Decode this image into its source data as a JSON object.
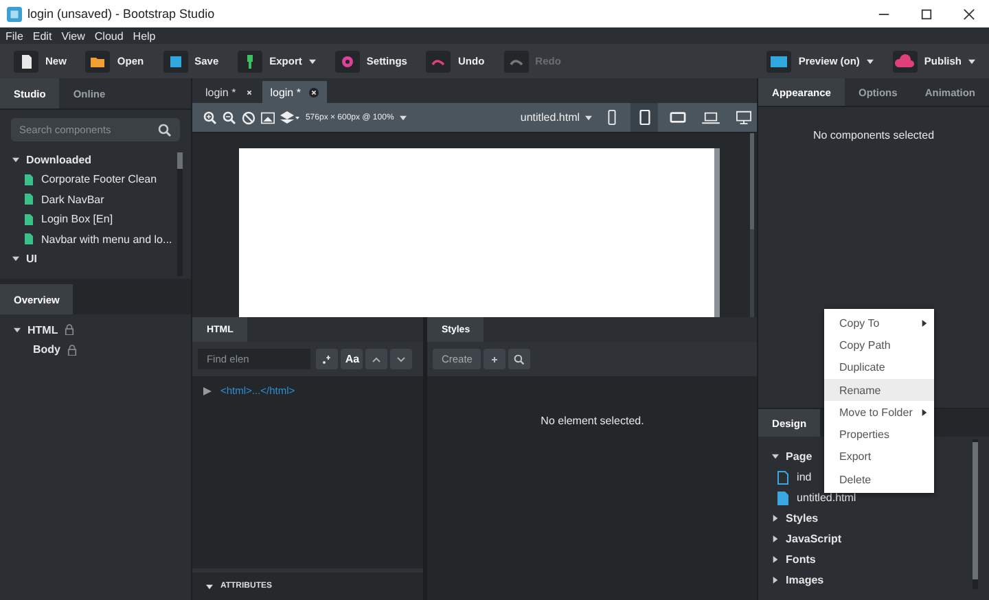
{
  "window": {
    "title": "login (unsaved) - Bootstrap Studio"
  },
  "menu": [
    "File",
    "Edit",
    "View",
    "Cloud",
    "Help"
  ],
  "toolbar": [
    {
      "kind": "new",
      "label": "New",
      "dropdown": false,
      "disabled": false
    },
    {
      "kind": "open",
      "label": "Open",
      "dropdown": false,
      "disabled": false
    },
    {
      "kind": "save",
      "label": "Save",
      "dropdown": false,
      "disabled": false
    },
    {
      "kind": "export",
      "label": "Export",
      "dropdown": true,
      "disabled": false
    },
    {
      "kind": "settings",
      "label": "Settings",
      "dropdown": false,
      "disabled": false
    },
    {
      "kind": "undo",
      "label": "Undo",
      "dropdown": false,
      "disabled": false
    },
    {
      "kind": "redo",
      "label": "Redo",
      "dropdown": false,
      "disabled": true
    }
  ],
  "toolbar_right": [
    {
      "kind": "preview",
      "label": "Preview (on)",
      "dropdown": true
    },
    {
      "kind": "publish",
      "label": "Publish",
      "dropdown": true
    }
  ],
  "left_tabs": [
    {
      "label": "Studio",
      "selected": true
    },
    {
      "label": "Online",
      "selected": false
    }
  ],
  "component_search": {
    "placeholder": "Search components"
  },
  "components": [
    {
      "label": "Downloaded",
      "expanded": true,
      "children": [
        {
          "label": "Corporate Footer Clean"
        },
        {
          "label": "Dark NavBar"
        },
        {
          "label": "Login Box [En]"
        },
        {
          "label": "Navbar with menu and lo..."
        }
      ]
    },
    {
      "label": "UI",
      "expanded": true
    }
  ],
  "overview": {
    "tab": "Overview",
    "tree": [
      {
        "label": "HTML",
        "expanded": true,
        "locked": true,
        "children": [
          {
            "label": "Body",
            "locked": true
          }
        ]
      }
    ]
  },
  "doc_tabs": [
    {
      "label": "login *",
      "selected": false
    },
    {
      "label": "login *",
      "selected": true
    }
  ],
  "canvas_toolbar": {
    "size": "576px × 600px @ 100%",
    "page": "untitled.html",
    "devices": [
      {
        "kind": "phone",
        "selected": false
      },
      {
        "kind": "tablet",
        "selected": true
      },
      {
        "kind": "tablet-landscape",
        "selected": false
      },
      {
        "kind": "laptop",
        "selected": false
      },
      {
        "kind": "desktop",
        "selected": false
      }
    ]
  },
  "html_panel": {
    "tab": "HTML",
    "find": {
      "placeholder": "Find elen"
    },
    "case_button": "Aa",
    "tree": [
      "<html>...</html>"
    ],
    "attributes": "ATTRIBUTES"
  },
  "styles_panel": {
    "tab": "Styles",
    "create": "Create",
    "message": "No element selected."
  },
  "right_tabs": [
    {
      "label": "Appearance",
      "selected": true
    },
    {
      "label": "Options",
      "selected": false
    },
    {
      "label": "Animation",
      "selected": false
    }
  ],
  "appearance_message": "No components selected",
  "design": {
    "tab": "Design",
    "tree": [
      {
        "label": "Page",
        "expanded": true,
        "children": [
          {
            "label": "ind",
            "kind": "outline"
          },
          {
            "label": "untitled.html",
            "kind": "filled"
          }
        ]
      },
      {
        "label": "Styles",
        "expanded": false
      },
      {
        "label": "JavaScript",
        "expanded": false
      },
      {
        "label": "Fonts",
        "expanded": false
      },
      {
        "label": "Images",
        "expanded": false
      }
    ]
  },
  "context_menu": [
    {
      "label": "Copy To",
      "submenu": true,
      "highlighted": false
    },
    {
      "label": "Copy Path",
      "submenu": false,
      "highlighted": false
    },
    {
      "label": "Duplicate",
      "submenu": false,
      "highlighted": false
    },
    {
      "label": "Rename",
      "submenu": false,
      "highlighted": true
    },
    {
      "label": "Move to Folder",
      "submenu": true,
      "highlighted": false
    },
    {
      "label": "Properties",
      "submenu": false,
      "highlighted": false
    },
    {
      "label": "Export",
      "submenu": false,
      "highlighted": false
    },
    {
      "label": "Delete",
      "submenu": false,
      "highlighted": false
    }
  ]
}
